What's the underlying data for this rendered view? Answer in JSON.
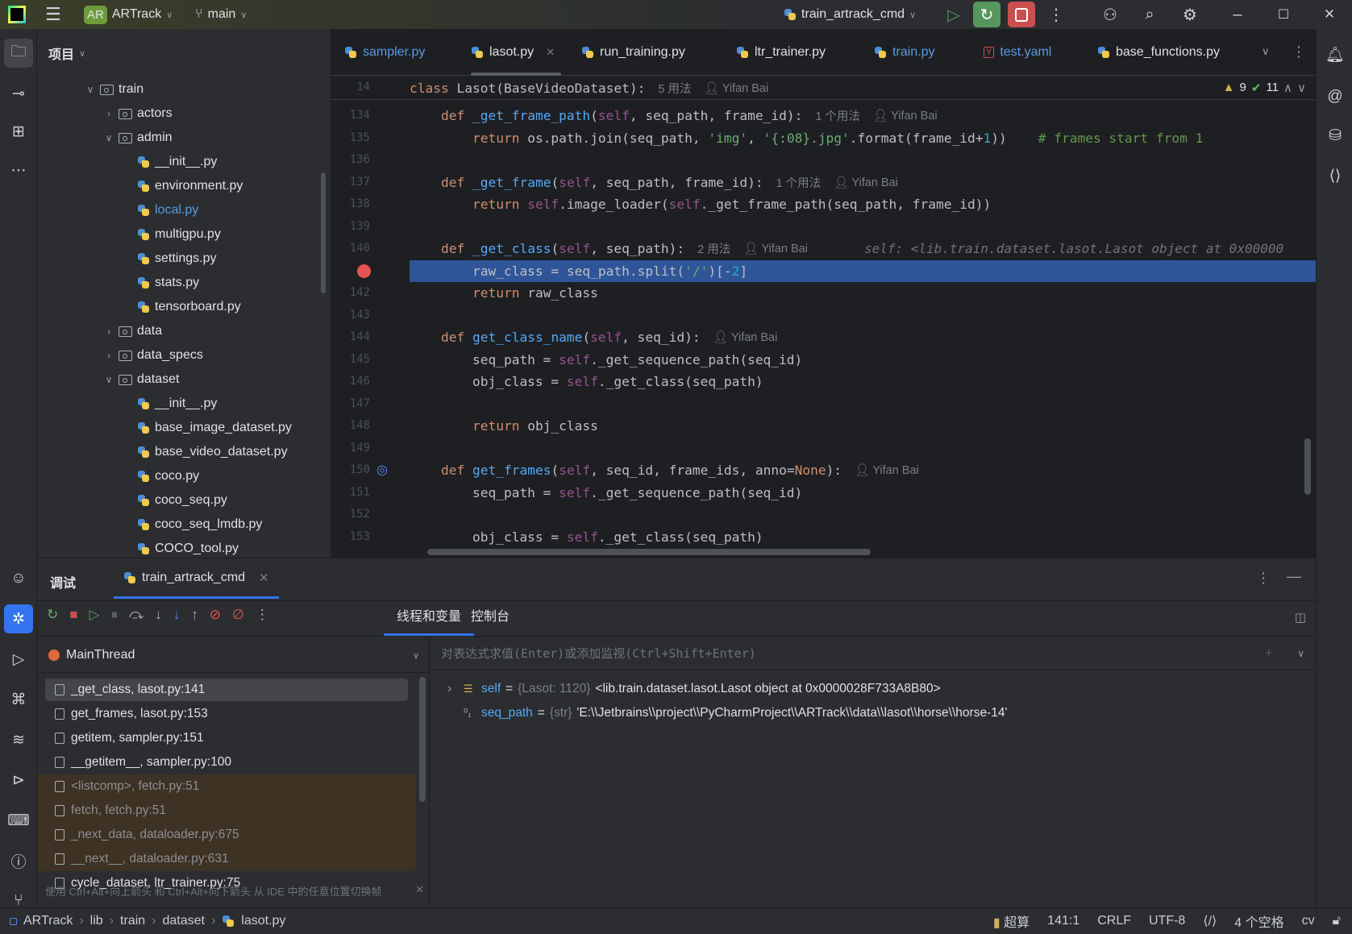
{
  "titlebar": {
    "project_badge": "AR",
    "project": "ARTrack",
    "branch": "main",
    "run_config": "train_artrack_cmd"
  },
  "project_panel": {
    "title": "项目",
    "tree": [
      {
        "label": "train",
        "depth": 0,
        "type": "folder",
        "open": true
      },
      {
        "label": "actors",
        "depth": 1,
        "type": "folder",
        "open": false
      },
      {
        "label": "admin",
        "depth": 1,
        "type": "folder",
        "open": true
      },
      {
        "label": "__init__.py",
        "depth": 2,
        "type": "py"
      },
      {
        "label": "environment.py",
        "depth": 2,
        "type": "py"
      },
      {
        "label": "local.py",
        "depth": 2,
        "type": "py",
        "blue": true
      },
      {
        "label": "multigpu.py",
        "depth": 2,
        "type": "py"
      },
      {
        "label": "settings.py",
        "depth": 2,
        "type": "py"
      },
      {
        "label": "stats.py",
        "depth": 2,
        "type": "py"
      },
      {
        "label": "tensorboard.py",
        "depth": 2,
        "type": "py"
      },
      {
        "label": "data",
        "depth": 1,
        "type": "folder",
        "open": false
      },
      {
        "label": "data_specs",
        "depth": 1,
        "type": "folder",
        "open": false
      },
      {
        "label": "dataset",
        "depth": 1,
        "type": "folder",
        "open": true
      },
      {
        "label": "__init__.py",
        "depth": 2,
        "type": "py"
      },
      {
        "label": "base_image_dataset.py",
        "depth": 2,
        "type": "py"
      },
      {
        "label": "base_video_dataset.py",
        "depth": 2,
        "type": "py"
      },
      {
        "label": "coco.py",
        "depth": 2,
        "type": "py"
      },
      {
        "label": "coco_seq.py",
        "depth": 2,
        "type": "py"
      },
      {
        "label": "coco_seq_lmdb.py",
        "depth": 2,
        "type": "py"
      },
      {
        "label": "COCO_tool.py",
        "depth": 2,
        "type": "py"
      }
    ]
  },
  "tabs": [
    {
      "label": "sampler.py",
      "type": "py",
      "blue": true
    },
    {
      "label": "lasot.py",
      "type": "py",
      "active": true
    },
    {
      "label": "run_training.py",
      "type": "py"
    },
    {
      "label": "ltr_trainer.py",
      "type": "py"
    },
    {
      "label": "train.py",
      "type": "py",
      "blue": true
    },
    {
      "label": "test.yaml",
      "type": "yaml",
      "blue": true
    },
    {
      "label": "base_functions.py",
      "type": "py"
    }
  ],
  "editor": {
    "sticky": {
      "line": "14",
      "tokens": [
        [
          "k",
          "class"
        ],
        [
          "p",
          " "
        ],
        [
          "p",
          "Lasot(BaseVideoDataset):"
        ]
      ],
      "usages": "5 用法",
      "author": "Yifan Bai"
    },
    "warnings": "9",
    "checks": "11",
    "lines": [
      {
        "n": "134",
        "t": [
          [
            "p",
            "    "
          ],
          [
            "k",
            "def"
          ],
          [
            "p",
            " "
          ],
          [
            "f",
            "_get_frame_path"
          ],
          [
            "p",
            "("
          ],
          [
            "s",
            "self"
          ],
          [
            "p",
            ", seq_path, frame_id):"
          ]
        ],
        "hint": "1 个用法",
        "author": "Yifan Bai"
      },
      {
        "n": "135",
        "t": [
          [
            "p",
            "        "
          ],
          [
            "k",
            "return"
          ],
          [
            "p",
            " os.path.join(seq_path, "
          ],
          [
            "g",
            "'img'"
          ],
          [
            "p",
            ", "
          ],
          [
            "g",
            "'{:08}.jpg'"
          ],
          [
            "p",
            ".format(frame_id+"
          ],
          [
            "n",
            "1"
          ],
          [
            "p",
            "))    "
          ],
          [
            "c",
            "# frames start from 1"
          ]
        ]
      },
      {
        "n": "136",
        "t": []
      },
      {
        "n": "137",
        "t": [
          [
            "p",
            "    "
          ],
          [
            "k",
            "def"
          ],
          [
            "p",
            " "
          ],
          [
            "f",
            "_get_frame"
          ],
          [
            "p",
            "("
          ],
          [
            "s",
            "self"
          ],
          [
            "p",
            ", seq_path, frame_id):"
          ]
        ],
        "hint": "1 个用法",
        "author": "Yifan Bai"
      },
      {
        "n": "138",
        "t": [
          [
            "p",
            "        "
          ],
          [
            "k",
            "return"
          ],
          [
            "p",
            " "
          ],
          [
            "s",
            "self"
          ],
          [
            "p",
            ".image_loader("
          ],
          [
            "s",
            "self"
          ],
          [
            "p",
            "._get_frame_path(seq_path, frame_id))"
          ]
        ]
      },
      {
        "n": "139",
        "t": []
      },
      {
        "n": "140",
        "t": [
          [
            "p",
            "    "
          ],
          [
            "k",
            "def"
          ],
          [
            "p",
            " "
          ],
          [
            "f",
            "_get_class"
          ],
          [
            "p",
            "("
          ],
          [
            "s",
            "self"
          ],
          [
            "p",
            ", seq_path):"
          ]
        ],
        "hint": "2 用法",
        "author": "Yifan Bai",
        "debug": "self: <lib.train.dataset.lasot.Lasot object at 0x00000"
      },
      {
        "n": "",
        "t": [
          [
            "p",
            "        raw_class = seq_path.split("
          ],
          [
            "g",
            "'/'"
          ],
          [
            "p",
            ")[-"
          ],
          [
            "n",
            "2"
          ],
          [
            "p",
            "]"
          ]
        ],
        "current": true,
        "breakpoint": true
      },
      {
        "n": "142",
        "t": [
          [
            "p",
            "        "
          ],
          [
            "k",
            "return"
          ],
          [
            "p",
            " raw_class"
          ]
        ]
      },
      {
        "n": "143",
        "t": []
      },
      {
        "n": "144",
        "t": [
          [
            "p",
            "    "
          ],
          [
            "k",
            "def"
          ],
          [
            "p",
            " "
          ],
          [
            "f",
            "get_class_name"
          ],
          [
            "p",
            "("
          ],
          [
            "s",
            "self"
          ],
          [
            "p",
            ", seq_id):"
          ]
        ],
        "author": "Yifan Bai"
      },
      {
        "n": "145",
        "t": [
          [
            "p",
            "        seq_path = "
          ],
          [
            "s",
            "self"
          ],
          [
            "p",
            "._get_sequence_path(seq_id)"
          ]
        ]
      },
      {
        "n": "146",
        "t": [
          [
            "p",
            "        obj_class = "
          ],
          [
            "s",
            "self"
          ],
          [
            "p",
            "._get_class(seq_path)"
          ]
        ]
      },
      {
        "n": "147",
        "t": []
      },
      {
        "n": "148",
        "t": [
          [
            "p",
            "        "
          ],
          [
            "k",
            "return"
          ],
          [
            "p",
            " obj_class"
          ]
        ]
      },
      {
        "n": "149",
        "t": []
      },
      {
        "n": "150",
        "t": [
          [
            "p",
            "    "
          ],
          [
            "k",
            "def"
          ],
          [
            "p",
            " "
          ],
          [
            "f",
            "get_frames"
          ],
          [
            "p",
            "("
          ],
          [
            "s",
            "self"
          ],
          [
            "p",
            ", seq_id, frame_ids, anno="
          ],
          [
            "k",
            "None"
          ],
          [
            "p",
            "):"
          ]
        ],
        "author": "Yifan Bai",
        "override": true
      },
      {
        "n": "151",
        "t": [
          [
            "p",
            "        seq_path = "
          ],
          [
            "s",
            "self"
          ],
          [
            "p",
            "._get_sequence_path(seq_id)"
          ]
        ]
      },
      {
        "n": "152",
        "t": []
      },
      {
        "n": "153",
        "t": [
          [
            "p",
            "        obj_class = "
          ],
          [
            "s",
            "self"
          ],
          [
            "p",
            "._get_class(seq_path)"
          ]
        ]
      }
    ]
  },
  "debug": {
    "title": "调试",
    "session": "train_artrack_cmd",
    "tabs": [
      {
        "label": "线程和变量",
        "active": true
      },
      {
        "label": "控制台"
      }
    ],
    "thread": "MainThread",
    "eval_placeholder": "对表达式求值(Enter)或添加监视(Ctrl+Shift+Enter)",
    "frames": [
      {
        "label": "_get_class, lasot.py:141",
        "selected": true
      },
      {
        "label": "get_frames, lasot.py:153"
      },
      {
        "label": "getitem, sampler.py:151"
      },
      {
        "label": "__getitem__, sampler.py:100"
      },
      {
        "label": "<listcomp>, fetch.py:51",
        "lib": true
      },
      {
        "label": "fetch, fetch.py:51",
        "lib": true
      },
      {
        "label": "_next_data, dataloader.py:675",
        "lib": true
      },
      {
        "label": "__next__, dataloader.py:631",
        "lib": true
      },
      {
        "label": "cycle_dataset, ltr_trainer.py:75"
      }
    ],
    "frames_tip": "使用 Ctrl+Alt+向上箭头 和 Ctrl+Alt+向下箭头 从 IDE 中的任意位置切换帧",
    "variables": [
      {
        "name": "self",
        "type": "{Lasot: 1120}",
        "value": "<lib.train.dataset.lasot.Lasot object at 0x0000028F733A8B80>",
        "expandable": true,
        "icon": "object-icon"
      },
      {
        "name": "seq_path",
        "type": "{str}",
        "value": "'E:\\\\Jetbrains\\\\project\\\\PyCharmProject\\\\ARTrack\\\\data\\\\lasot\\\\horse\\\\horse-14'",
        "icon": "binary-icon"
      }
    ]
  },
  "status": {
    "breadcrumb": [
      "ARTrack",
      "lib",
      "train",
      "dataset",
      "lasot.py"
    ],
    "plugin": "超算",
    "position": "141:1",
    "line_sep": "CRLF",
    "encoding": "UTF-8",
    "indent": "4 个空格",
    "interpreter": "cv"
  },
  "colors": {
    "accent": "#3574f0",
    "current_line": "#2f5599",
    "breakpoint": "#e55353",
    "run_green": "#57965c",
    "stop_red": "#c94f4f",
    "lib_frame_bg": "#3d3223"
  }
}
